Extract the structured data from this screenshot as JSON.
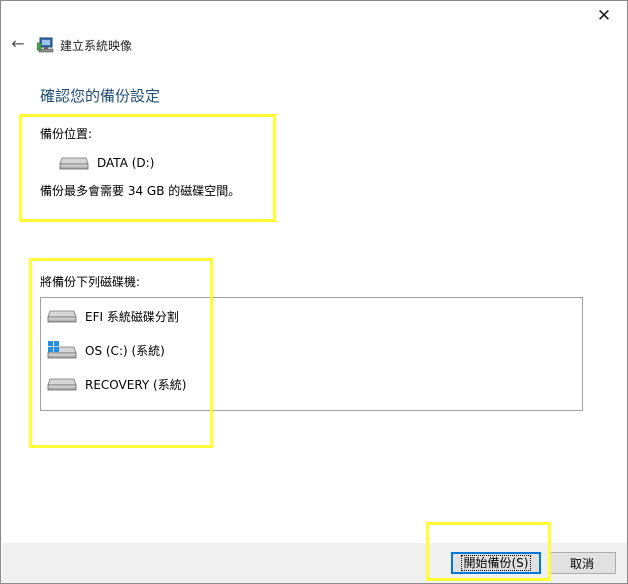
{
  "window": {
    "close_glyph": "✕",
    "back_glyph": "←",
    "title": "建立系統映像"
  },
  "heading": "確認您的備份設定",
  "backup_location": {
    "label": "備份位置:",
    "drive": "DATA (D:)",
    "space_note": "備份最多會需要 34 GB 的磁碟空間。"
  },
  "drives_section": {
    "label": "將備份下列磁碟機:",
    "drives": [
      {
        "label": "EFI 系統磁碟分割",
        "icon": "drive-icon"
      },
      {
        "label": "OS (C:) (系統)",
        "icon": "windows-drive-icon"
      },
      {
        "label": "RECOVERY (系統)",
        "icon": "drive-icon"
      }
    ]
  },
  "buttons": {
    "start": "開始備份(S)",
    "cancel": "取消"
  },
  "colors": {
    "highlight": "#ffff33",
    "heading": "#1f4e79",
    "accent": "#0078d7"
  }
}
